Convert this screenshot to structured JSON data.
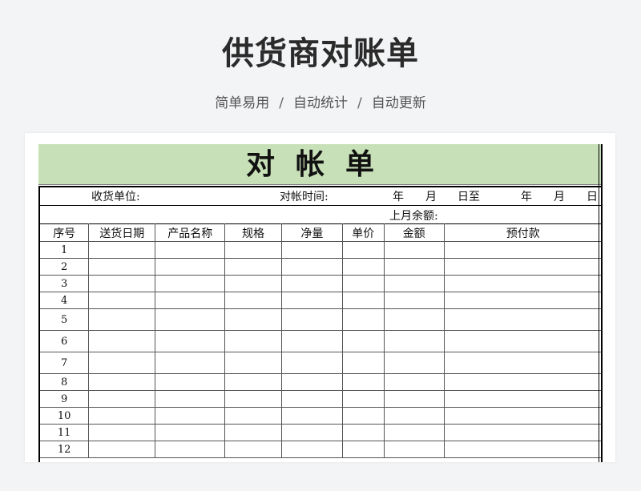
{
  "page": {
    "title": "供货商对账单",
    "subtitle_items": [
      "简单易用",
      "自动统计",
      "自动更新"
    ],
    "separator": "/"
  },
  "sheet": {
    "title": "对帐单",
    "title_bg": "#c8e0b8",
    "info": {
      "receiver_label": "收货单位:",
      "time_label": "对帐时间:",
      "year": "年",
      "month": "月",
      "day_to": "日至",
      "year2": "年",
      "month2": "月",
      "day2": "日",
      "prev_balance_label": "上月余额:"
    },
    "columns": [
      "序号",
      "送货日期",
      "产品名称",
      "规格",
      "净量",
      "单价",
      "金额",
      "预付款"
    ],
    "rows": [
      "1",
      "2",
      "3",
      "4",
      "5",
      "6",
      "7",
      "8",
      "9",
      "10",
      "11",
      "12"
    ]
  }
}
